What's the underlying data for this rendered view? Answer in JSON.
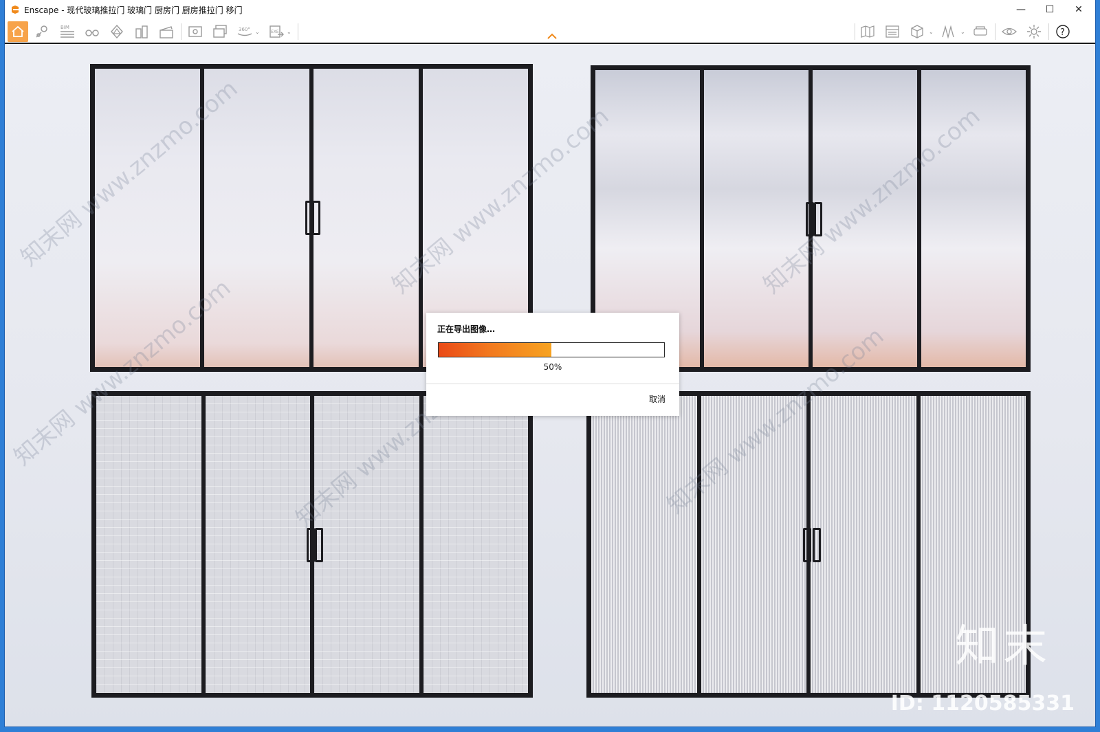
{
  "window": {
    "app_name": "Enscape",
    "title": "Enscape - 现代玻璃推拉门 玻璃门 厨房门 厨房推拉门 移门",
    "controls": {
      "minimize": "—",
      "maximize": "☐",
      "close": "✕"
    }
  },
  "toolbar": {
    "left_items": [
      {
        "name": "home-icon",
        "label": ""
      },
      {
        "name": "location-icon",
        "label": ""
      },
      {
        "name": "bim-icon",
        "label": "BIM"
      },
      {
        "name": "binoculars-icon",
        "label": ""
      },
      {
        "name": "atmosphere-icon",
        "label": ""
      },
      {
        "name": "buildings-icon",
        "label": ""
      },
      {
        "name": "clapper-icon",
        "label": ""
      },
      {
        "name": "screenshot-icon",
        "label": ""
      },
      {
        "name": "batch-render-icon",
        "label": ""
      },
      {
        "name": "panorama-icon",
        "label": "360°"
      },
      {
        "name": "export-exe-icon",
        "label": "EXE"
      }
    ],
    "right_items": [
      {
        "name": "asset-library-icon"
      },
      {
        "name": "material-editor-icon"
      },
      {
        "name": "cube-icon"
      },
      {
        "name": "views-icon"
      },
      {
        "name": "vr-headset-icon"
      },
      {
        "name": "eye-icon"
      },
      {
        "name": "gear-icon"
      },
      {
        "name": "help-icon"
      }
    ],
    "help_label": "?"
  },
  "viewport": {
    "watermark_text": "知末网 www.znzmo.com",
    "brand_mark": "知末",
    "brand_id": "ID: 1120585331"
  },
  "export_dialog": {
    "title": "正在导出图像…",
    "progress_fraction": 0.5,
    "progress_text": "50%",
    "cancel_label": "取消"
  },
  "colors": {
    "accent": "#f7a34a",
    "progress_start": "#ea4a17",
    "progress_end": "#f7a321",
    "frame": "#1c1c20",
    "desktop": "#2f7fd6"
  }
}
